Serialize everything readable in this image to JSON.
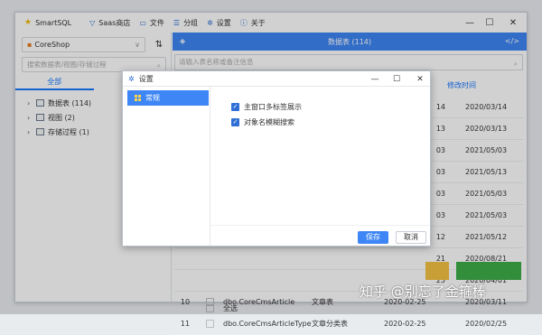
{
  "titlebar": {
    "app_name": "SmartSQL",
    "menu": [
      {
        "icon": "store-icon",
        "label": "Saas商店"
      },
      {
        "icon": "file-icon",
        "label": "文件"
      },
      {
        "icon": "group-icon",
        "label": "分组"
      },
      {
        "icon": "gear-icon",
        "label": "设置"
      },
      {
        "icon": "info-icon",
        "label": "关于"
      }
    ]
  },
  "sidebar": {
    "db_selected": "CoreShop",
    "search_placeholder": "搜索数据表/视图/存储过程",
    "tab_all": "全部",
    "tree": [
      {
        "label": "数据表 (114)"
      },
      {
        "label": "视图 (2)"
      },
      {
        "label": "存储过程 (1)"
      }
    ]
  },
  "main": {
    "header_title": "数据表 (114)",
    "search_placeholder": "请输入表名称或备注信息",
    "col_modified": "修改时间",
    "rows": [
      {
        "no": "",
        "name": "",
        "comment": "",
        "created": "14",
        "modified": "2020/03/14"
      },
      {
        "no": "",
        "name": "",
        "comment": "",
        "created": "13",
        "modified": "2020/03/13"
      },
      {
        "no": "",
        "name": "",
        "comment": "",
        "created": "03",
        "modified": "2021/05/03"
      },
      {
        "no": "",
        "name": "",
        "comment": "",
        "created": "03",
        "modified": "2021/05/13"
      },
      {
        "no": "",
        "name": "",
        "comment": "",
        "created": "03",
        "modified": "2021/05/03"
      },
      {
        "no": "",
        "name": "",
        "comment": "",
        "created": "03",
        "modified": "2021/05/03"
      },
      {
        "no": "",
        "name": "",
        "comment": "",
        "created": "12",
        "modified": "2021/05/12"
      },
      {
        "no": "",
        "name": "",
        "comment": "",
        "created": "21",
        "modified": "2020/08/21"
      },
      {
        "no": "",
        "name": "",
        "comment": "",
        "created": "25",
        "modified": "2020/04/01"
      },
      {
        "no": "10",
        "name": "dbo.CoreCmsArticle",
        "comment": "文章表",
        "created": "2020-02-25",
        "modified": "2020/03/11"
      },
      {
        "no": "11",
        "name": "dbo.CoreCmsArticleType",
        "comment": "文章分类表",
        "created": "2020-02-25",
        "modified": "2020/02/25"
      }
    ],
    "select_all": "全选"
  },
  "dialog": {
    "title": "设置",
    "nav_item": "常规",
    "option1": "主窗口多标签展示",
    "option2": "对象名模糊搜索",
    "save": "保存",
    "cancel": "取消"
  },
  "watermark": "知乎 @别忘了金箍棒"
}
